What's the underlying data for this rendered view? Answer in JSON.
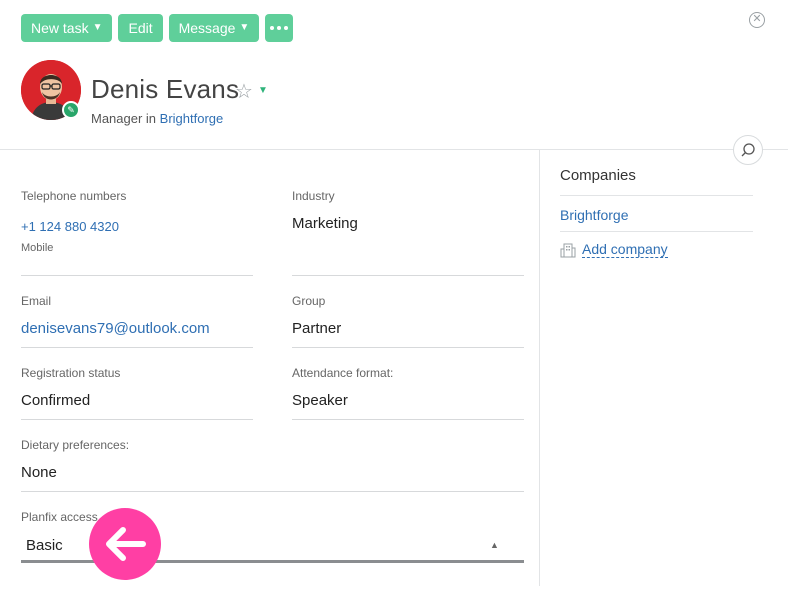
{
  "toolbar": {
    "new_task": "New task",
    "edit": "Edit",
    "message": "Message"
  },
  "icons": {
    "caret": "caret-down-icon",
    "more": "more-dots-icon",
    "close": "close-circle-icon",
    "star": "star-outline-icon",
    "search": "search-icon",
    "edit": "pencil-icon",
    "arrow": "arrow-left-icon",
    "company": "building-icon"
  },
  "colors": {
    "accent": "#5fcf9a",
    "link": "#2f6fb3",
    "avatar_bg": "#d9252b",
    "arrow_bg": "#ff3fa4"
  },
  "contact": {
    "name": "Denis Evans",
    "role_prefix": "Manager in",
    "company": "Brightforge"
  },
  "fields": {
    "telephone": {
      "label": "Telephone numbers",
      "value": "+1 124 880 4320",
      "type": "Mobile"
    },
    "industry": {
      "label": "Industry",
      "value": "Marketing"
    },
    "email": {
      "label": "Email",
      "value": "denisevans79@outlook.com"
    },
    "group": {
      "label": "Group",
      "value": "Partner"
    },
    "registration": {
      "label": "Registration status",
      "value": "Confirmed"
    },
    "attendance": {
      "label": "Attendance format:",
      "value": "Speaker"
    },
    "dietary": {
      "label": "Dietary preferences:",
      "value": "None"
    },
    "planfix": {
      "label": "Planfix access",
      "value": "Basic"
    }
  },
  "companies": {
    "title": "Companies",
    "items": [
      "Brightforge"
    ],
    "add_label": "Add company"
  }
}
